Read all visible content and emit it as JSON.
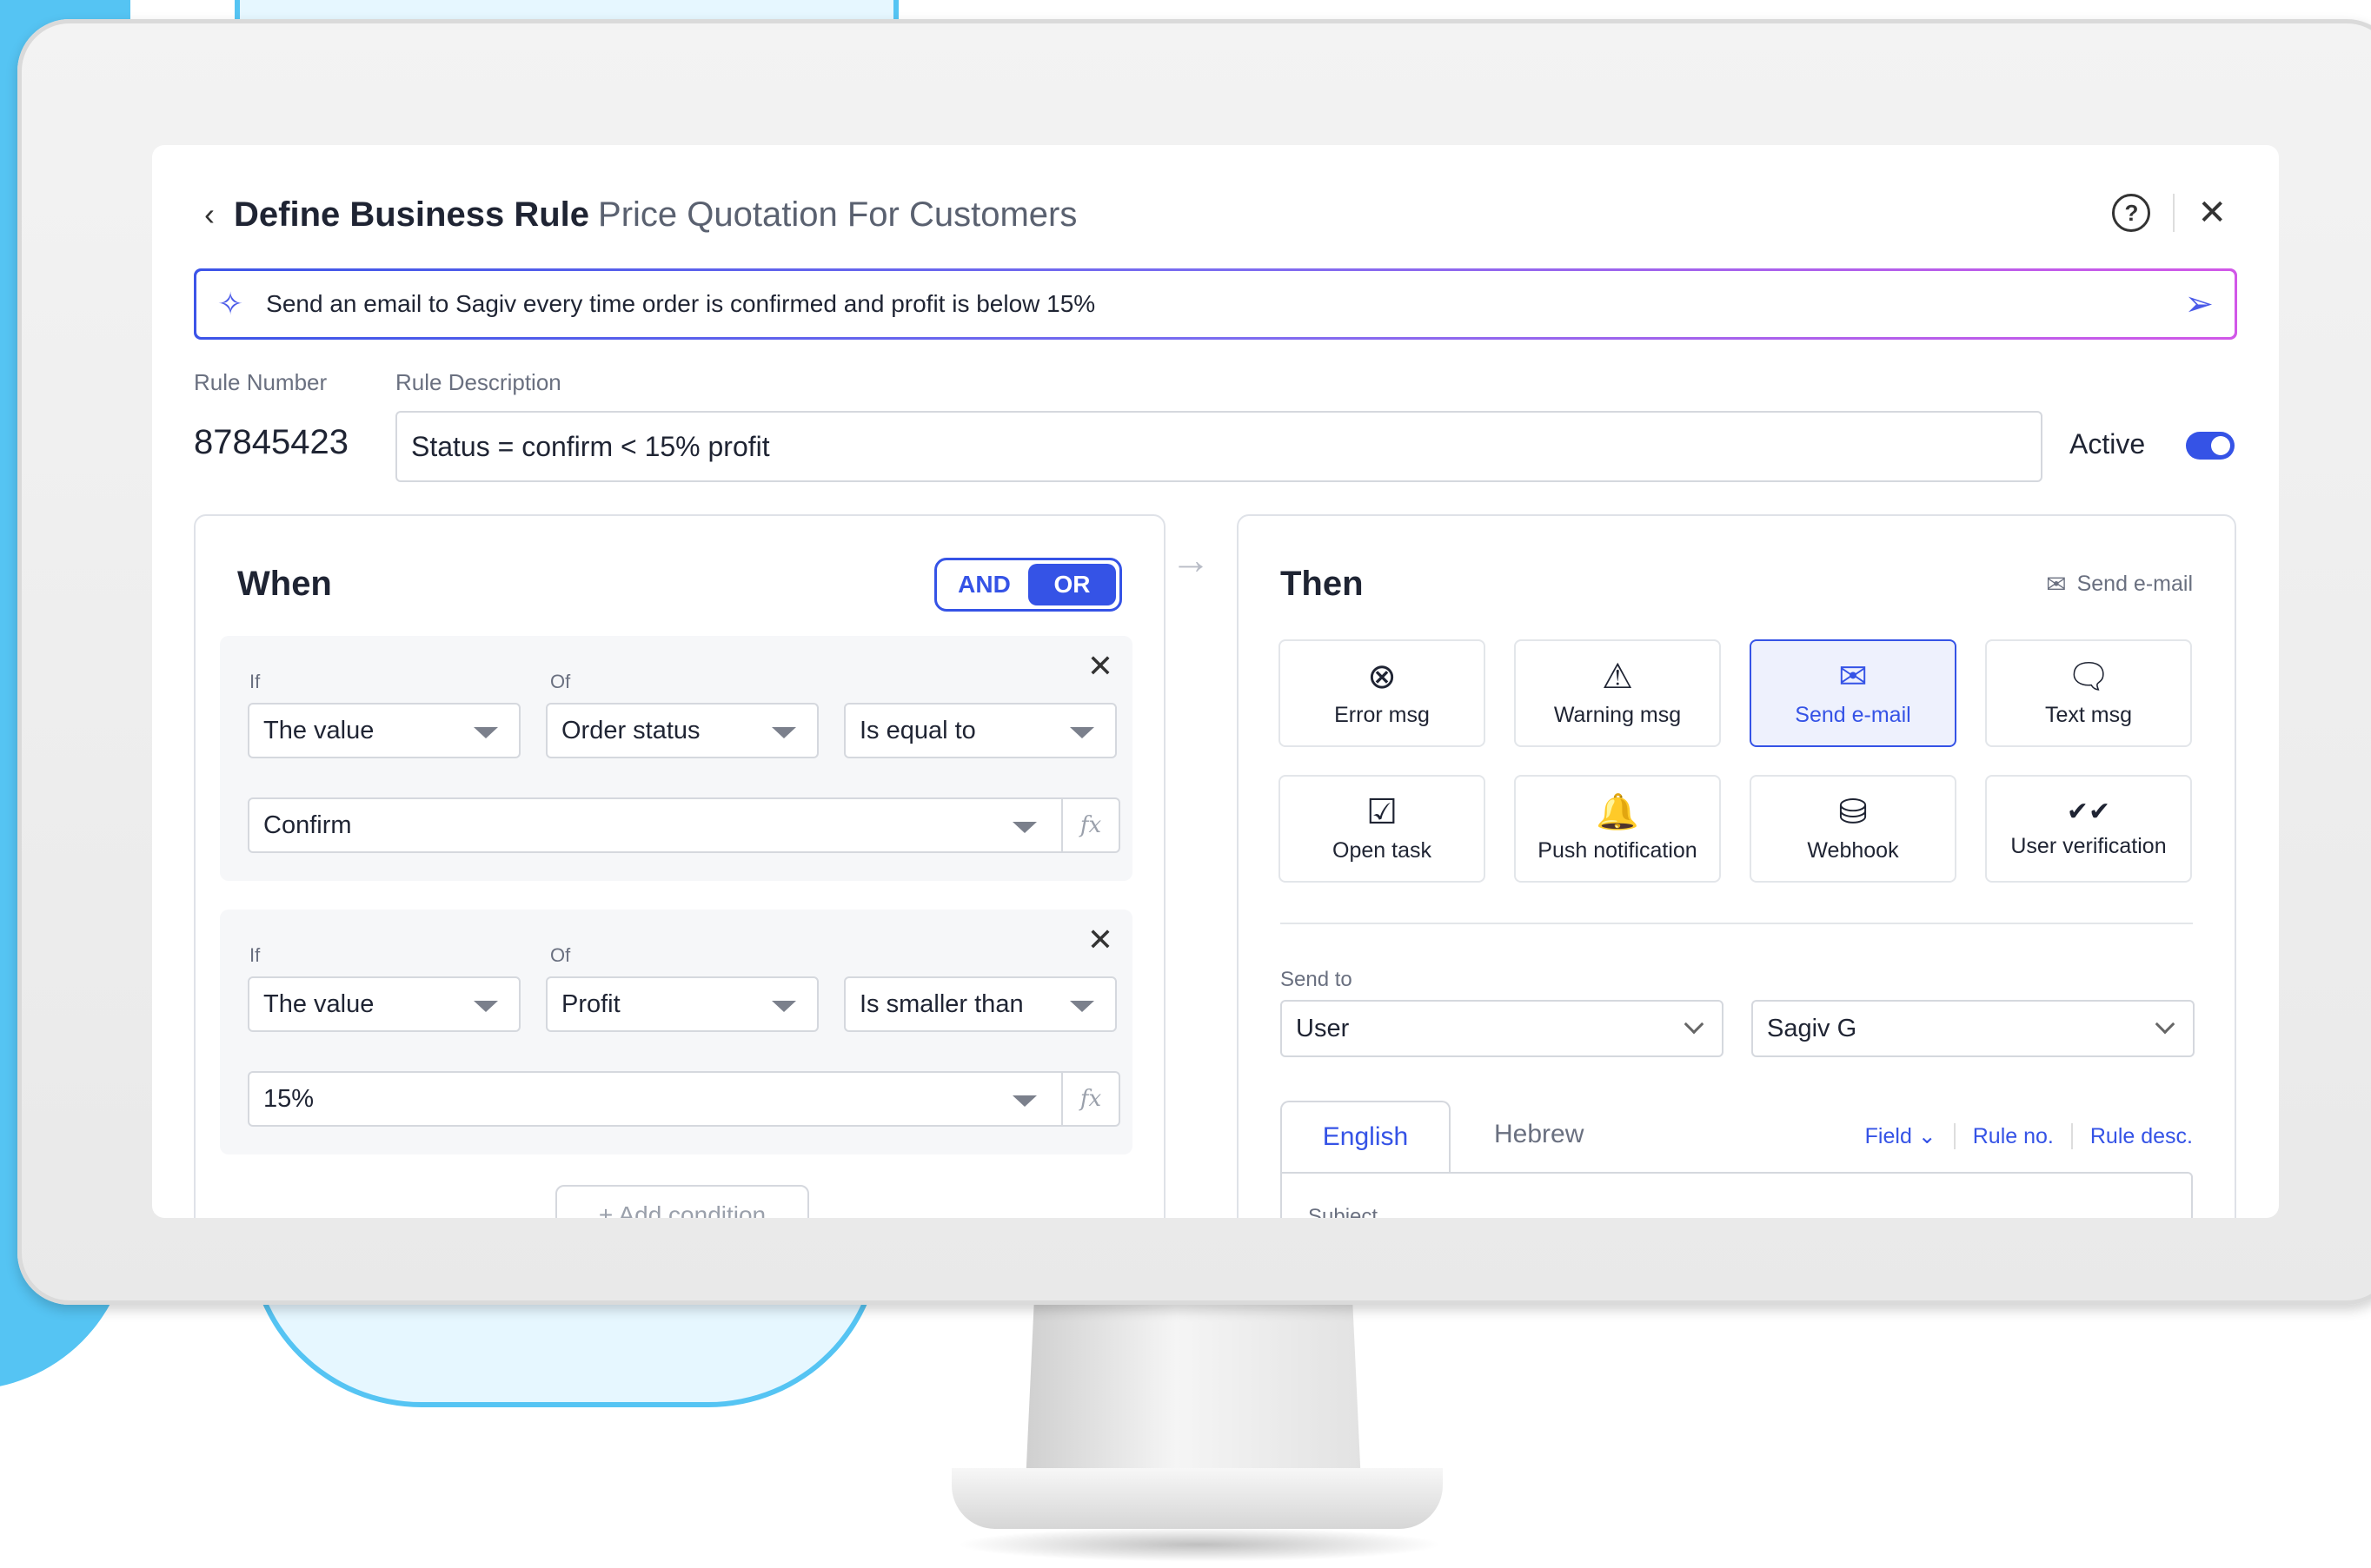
{
  "header": {
    "title": "Define Business Rule",
    "subtitle": "Price Quotation For Customers",
    "back_icon": "‹",
    "help_icon": "?",
    "close_icon": "✕"
  },
  "ai_bar": {
    "text": "Send an email to Sagiv every time order is confirmed and profit is below 15%",
    "sparkle_icon": "✧",
    "send_icon": "➢"
  },
  "rule": {
    "number_label": "Rule Number",
    "number": "87845423",
    "description_label": "Rule Description",
    "description": "Status = confirm < 15% profit",
    "active_label": "Active",
    "active": true
  },
  "when": {
    "title": "When",
    "and_label": "AND",
    "or_label": "OR",
    "selected_logic": "OR",
    "conditions": [
      {
        "if_label": "If",
        "of_label": "Of",
        "subject": "The value",
        "field": "Order status",
        "operator": "Is equal to",
        "value": "Confirm"
      },
      {
        "if_label": "If",
        "of_label": "Of",
        "subject": "The value",
        "field": "Profit",
        "operator": "Is smaller than",
        "value": "15%"
      }
    ],
    "fx_label": "fx",
    "add_condition": "+ Add condition"
  },
  "then": {
    "title": "Then",
    "selected_action_label": "Send e-mail",
    "actions": [
      {
        "label": "Error msg",
        "icon": "⊗"
      },
      {
        "label": "Warning msg",
        "icon": "⚠"
      },
      {
        "label": "Send e-mail",
        "icon": "✉"
      },
      {
        "label": "Text msg",
        "icon": "🗨"
      },
      {
        "label": "Open task",
        "icon": "☑"
      },
      {
        "label": "Push notification",
        "icon": "🔔"
      },
      {
        "label": "Webhook",
        "icon": "⛁"
      },
      {
        "label": "User verification",
        "icon": "✔✔"
      }
    ],
    "send_to_label": "Send to",
    "send_to_type": "User",
    "send_to_user": "Sagiv G",
    "tabs": [
      "English",
      "Hebrew"
    ],
    "active_tab": "English",
    "field_link": "Field ⌄",
    "rule_no_link": "Rule no.",
    "rule_desc_link": "Rule desc.",
    "subject_label": "Subject"
  },
  "colors": {
    "accent": "#3553e6",
    "backdrop_blue": "#55c4f3",
    "backdrop_light": "#e6f7ff"
  }
}
